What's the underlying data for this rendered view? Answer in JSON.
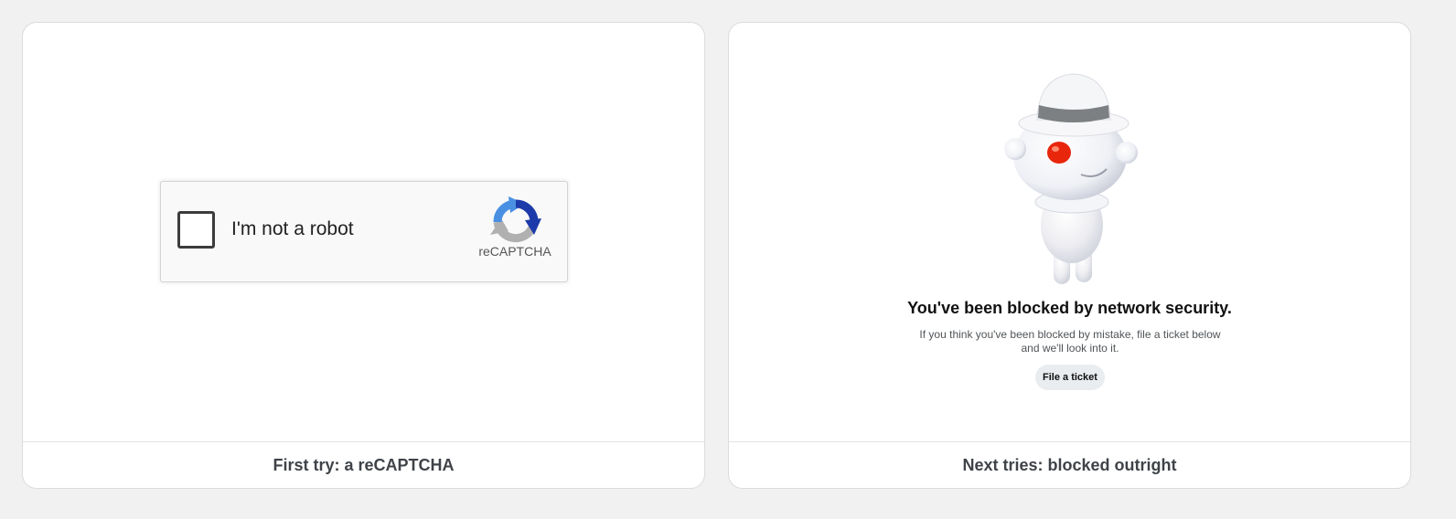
{
  "left_panel": {
    "caption": "First try: a reCAPTCHA",
    "captcha": {
      "label": "I'm not a robot",
      "brand": "reCAPTCHA",
      "checked": false
    }
  },
  "right_panel": {
    "caption": "Next tries: blocked outright",
    "title": "You've been blocked by network security.",
    "message": "If you think you've been blocked by mistake, file a ticket below and we'll look into it.",
    "button_label": "File a ticket",
    "mascot": "reddit-snoo-mascot-in-fedora"
  },
  "colors": {
    "background": "#f1f1f2",
    "panel": "#ffffff",
    "recaptcha_blue": "#4a90e2",
    "recaptcha_dark_blue": "#1c3aa9",
    "recaptcha_gray": "#b0b0b0",
    "snoo_eye": "#e8260c",
    "button_bg": "#eaedef"
  }
}
